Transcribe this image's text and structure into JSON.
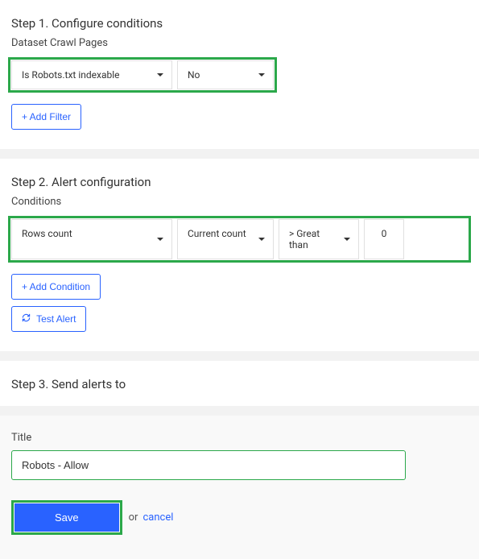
{
  "step1": {
    "header": "Step 1. Configure conditions",
    "dataset_label": "Dataset Crawl Pages",
    "field_select": "Is Robots.txt indexable",
    "value_select": "No",
    "add_filter_label": "+ Add Filter"
  },
  "step2": {
    "header": "Step 2. Alert configuration",
    "conditions_label": "Conditions",
    "col1": "Rows count",
    "col2": "Current count",
    "col3": "> Great than",
    "col4": "0",
    "add_condition_label": "+ Add Condition",
    "test_alert_label": "Test Alert"
  },
  "step3": {
    "header": "Step 3. Send alerts to",
    "title_label": "Title",
    "title_value": "Robots - Allow",
    "save_label": "Save",
    "or_text": "or",
    "cancel_label": "cancel"
  }
}
